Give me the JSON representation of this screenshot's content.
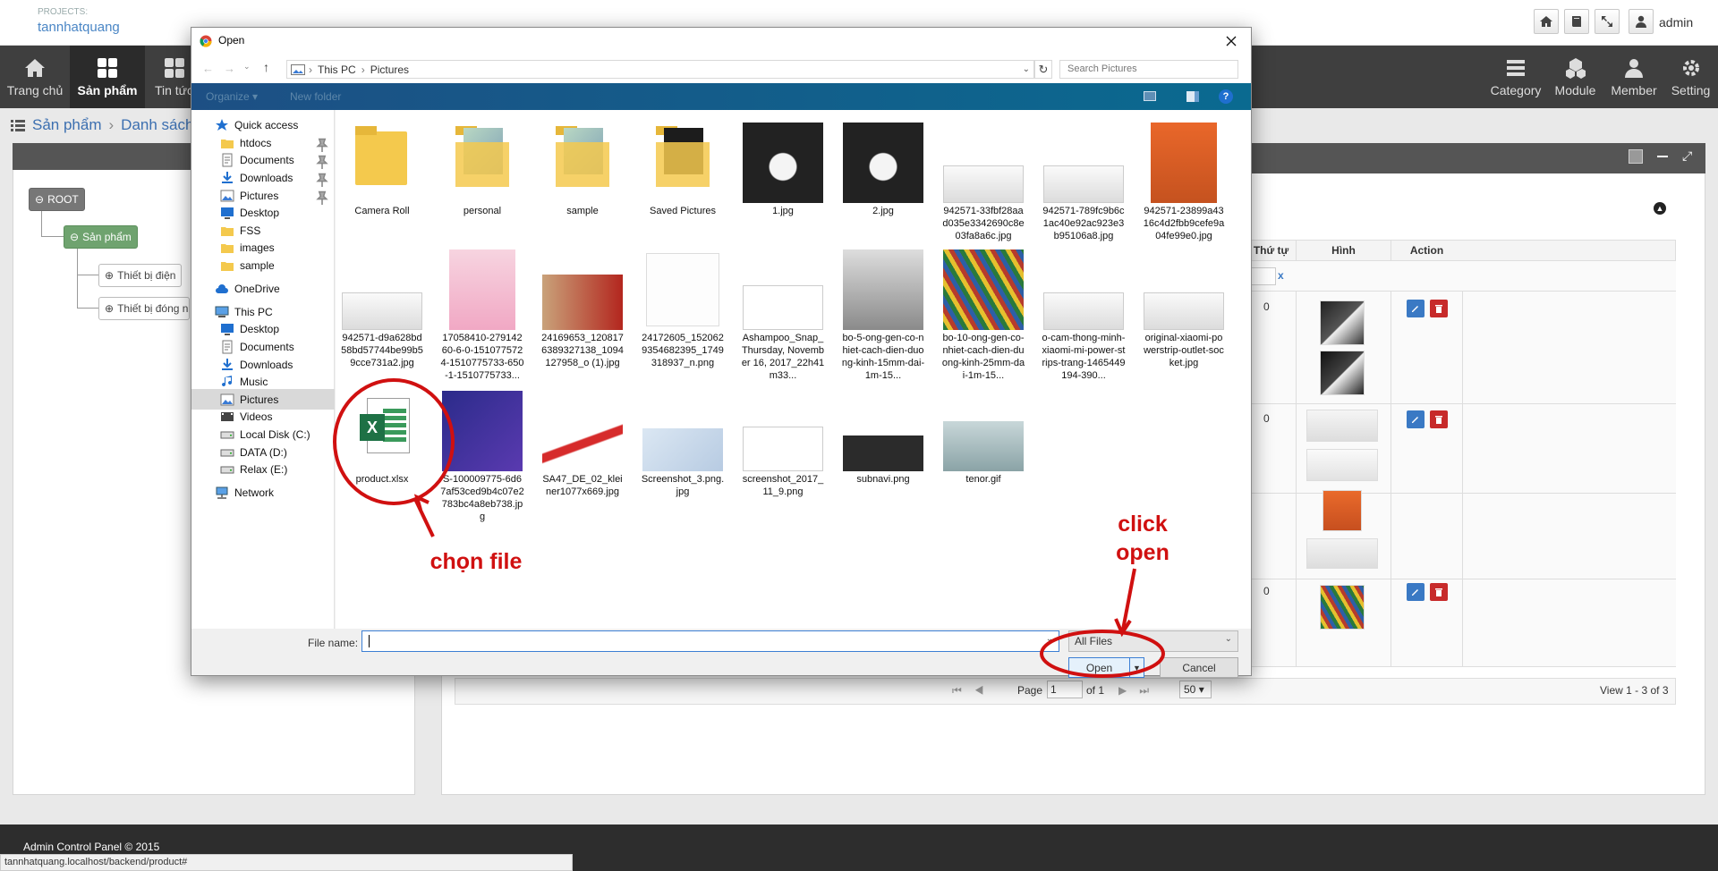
{
  "topbar": {
    "projects_caption": "PROJECTS:",
    "project_name": "tannhatquang",
    "user": "admin",
    "icons": [
      "home-icon",
      "book-icon",
      "fullscreen-icon",
      "user-icon"
    ]
  },
  "nav": {
    "left": [
      {
        "label": "Trang chủ",
        "icon": "home-icon"
      },
      {
        "label": "Sản phẩm",
        "icon": "grid-icon",
        "active": true
      },
      {
        "label": "Tin tức",
        "icon": "grid-icon"
      }
    ],
    "right": [
      {
        "label": "Category",
        "icon": "list-icon"
      },
      {
        "label": "Module",
        "icon": "cubes-icon"
      },
      {
        "label": "Member",
        "icon": "user-icon"
      },
      {
        "label": "Setting",
        "icon": "gear-icon"
      }
    ]
  },
  "breadcrumb": {
    "first": "Sản phẩm",
    "separator": "›",
    "second": "Danh sách"
  },
  "tree": {
    "root": "ROOT",
    "category": "Sản phẩm",
    "children": [
      "Thiết bị điện",
      "Thiết bị đóng ngắt"
    ]
  },
  "grid": {
    "columns": {
      "order": "Thứ tự",
      "image": "Hình",
      "action": "Action"
    },
    "filter_clear": "x",
    "rows": [
      {
        "order": "0"
      },
      {
        "order": "0"
      },
      {
        "order": "0"
      }
    ],
    "pager": {
      "page_label": "Page",
      "page_value": "1",
      "of_label": "of 1",
      "page_size": "50",
      "view_text": "View 1 - 3 of 3"
    }
  },
  "footer": {
    "text": "Admin Control Panel © 2015",
    "status_url": "tannhatquang.localhost/backend/product#"
  },
  "dialog": {
    "title": "Open",
    "address": {
      "segments": [
        "This PC",
        "Pictures"
      ],
      "separator": "›"
    },
    "search_placeholder": "Search Pictures",
    "toolbar": {
      "organize": "Organize ▾",
      "new_folder": "New folder"
    },
    "nav_items": [
      {
        "label": "Quick access",
        "icon": "star-icon",
        "group": true
      },
      {
        "label": "htdocs",
        "icon": "folder-icon",
        "pinned": true
      },
      {
        "label": "Documents",
        "icon": "documents-icon",
        "pinned": true
      },
      {
        "label": "Downloads",
        "icon": "download-icon",
        "pinned": true
      },
      {
        "label": "Pictures",
        "icon": "pictures-icon",
        "pinned": true
      },
      {
        "label": "Desktop",
        "icon": "desktop-icon"
      },
      {
        "label": "FSS",
        "icon": "folder-icon"
      },
      {
        "label": "images",
        "icon": "folder-icon"
      },
      {
        "label": "sample",
        "icon": "folder-icon"
      },
      {
        "label": "OneDrive",
        "icon": "cloud-icon",
        "group": true
      },
      {
        "label": "This PC",
        "icon": "computer-icon",
        "group": true
      },
      {
        "label": "Desktop",
        "icon": "desktop-icon"
      },
      {
        "label": "Documents",
        "icon": "documents-icon"
      },
      {
        "label": "Downloads",
        "icon": "download-icon"
      },
      {
        "label": "Music",
        "icon": "music-icon"
      },
      {
        "label": "Pictures",
        "icon": "pictures-icon",
        "selected": true
      },
      {
        "label": "Videos",
        "icon": "videos-icon"
      },
      {
        "label": "Local Disk (C:)",
        "icon": "drive-icon"
      },
      {
        "label": "DATA (D:)",
        "icon": "drive-icon"
      },
      {
        "label": "Relax (E:)",
        "icon": "drive-icon"
      },
      {
        "label": "Network",
        "icon": "network-icon",
        "group": true
      }
    ],
    "files": [
      {
        "name": "Camera Roll",
        "kind": "folder"
      },
      {
        "name": "personal",
        "kind": "folder-photo"
      },
      {
        "name": "sample",
        "kind": "folder-photo"
      },
      {
        "name": "Saved Pictures",
        "kind": "folder-dark"
      },
      {
        "name": "1.jpg",
        "kind": "img-dark"
      },
      {
        "name": "2.jpg",
        "kind": "img-dark"
      },
      {
        "name": "942571-33fbf28aad035e3342690c8e03fa8a6c.jpg",
        "kind": "img-light"
      },
      {
        "name": "942571-789fc9b6c1ac40e92ac923e3b95106a8.jpg",
        "kind": "img-light"
      },
      {
        "name": "942571-23899a4316c4d2fbb9cefe9a04fe99e0.jpg",
        "kind": "img-orange"
      },
      {
        "name": "942571-d9a628bd58bd57744be99b59cce731a2.jpg",
        "kind": "img-light"
      },
      {
        "name": "17058410-27914260-6-0-1510775724-1510775733-650-1-1510775733...",
        "kind": "img-pink"
      },
      {
        "name": "24169653_1208176389327138_1094127958_o (1).jpg",
        "kind": "img-red"
      },
      {
        "name": "24172605_1520629354682395_1749318937_n.png",
        "kind": "img-white"
      },
      {
        "name": "Ashampoo_Snap_Thursday, November 16, 2017_22h41m33...",
        "kind": "img-screen"
      },
      {
        "name": "bo-5-ong-gen-co-nhiet-cach-dien-duong-kinh-15mm-dai-1m-15...",
        "kind": "img-black-tube"
      },
      {
        "name": "bo-10-ong-gen-co-nhiet-cach-dien-duong-kinh-25mm-dai-1m-15...",
        "kind": "img-colors"
      },
      {
        "name": "o-cam-thong-minh-xiaomi-mi-power-strips-trang-1465449194-390...",
        "kind": "img-light"
      },
      {
        "name": "original-xiaomi-powerstrip-outlet-socket.jpg",
        "kind": "img-light"
      },
      {
        "name": "product.xlsx",
        "kind": "excel"
      },
      {
        "name": "S-100009775-6d67af53ced9b4c07e2783bc4a8eb738.jpg",
        "kind": "img-blue"
      },
      {
        "name": "SA47_DE_02_kleiner1077x669.jpg",
        "kind": "img-redcable"
      },
      {
        "name": "Screenshot_3.png.jpg",
        "kind": "img-map"
      },
      {
        "name": "screenshot_2017_11_9.png",
        "kind": "img-screen"
      },
      {
        "name": "subnavi.png",
        "kind": "img-code"
      },
      {
        "name": "tenor.gif",
        "kind": "img-penguin"
      }
    ],
    "file_name_label": "File name:",
    "file_name_value": "",
    "file_type": "All Files",
    "open_button": "Open",
    "cancel_button": "Cancel"
  },
  "annotations": {
    "choose_file": "chọn file",
    "click_open": "click\nopen"
  },
  "colors": {
    "accent": "#d01010",
    "nav_bg": "#3f3f3f",
    "toolbar_blue": "#0a6a90"
  }
}
